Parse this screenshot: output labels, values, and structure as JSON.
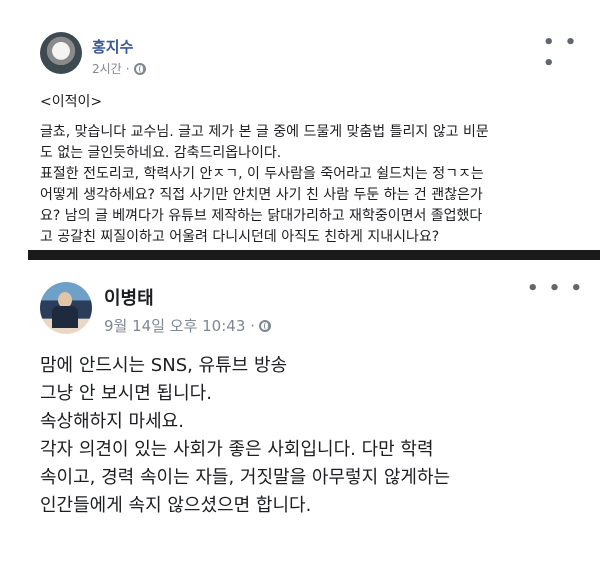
{
  "post1": {
    "author": "홍지수",
    "time": "2시간",
    "more_label": "• • •",
    "tag": "<이적이>",
    "lines": [
      "글쵸, 맞습니다 교수님. 글고 제가 본 글 중에 드물게 맞춤법 틀리지 않고 비문",
      "도 없는 글인듯하네요. 감축드리옵나이다.",
      "표절한 전도리코, 학력사기 안ㅈㄱ, 이 두사람을 죽어라고 쉴드치는 정ㄱㅈ는",
      "어떻게 생각하세요? 직접 사기만 안치면 사기 친 사람 두둔 하는 건 괜찮은가",
      "요? 남의 글 베껴다가 유튜브 제작하는 닭대가리하고 재학중이면서 졸업했다",
      "고 공갈친 찌질이하고 어울려 다니시던데 아직도 친하게 지내시나요?"
    ]
  },
  "post2": {
    "author": "이병태",
    "time": "9월 14일 오후 10:43 ·",
    "more_label": "• • •",
    "lines": [
      "맘에 안드시는 SNS,  유튜브 방송",
      "그냥 안 보시면 됩니다.",
      "속상해하지 마세요.",
      "각자 의견이 있는 사회가 좋은 사회입니다.  다만 학력",
      "속이고, 경력 속이는 자들, 거짓말을 아무렇지 않게하는",
      "인간들에게 속지 않으셨으면 합니다."
    ]
  },
  "icons": {
    "privacy": "globe-icon",
    "options": "more-options-icon"
  }
}
